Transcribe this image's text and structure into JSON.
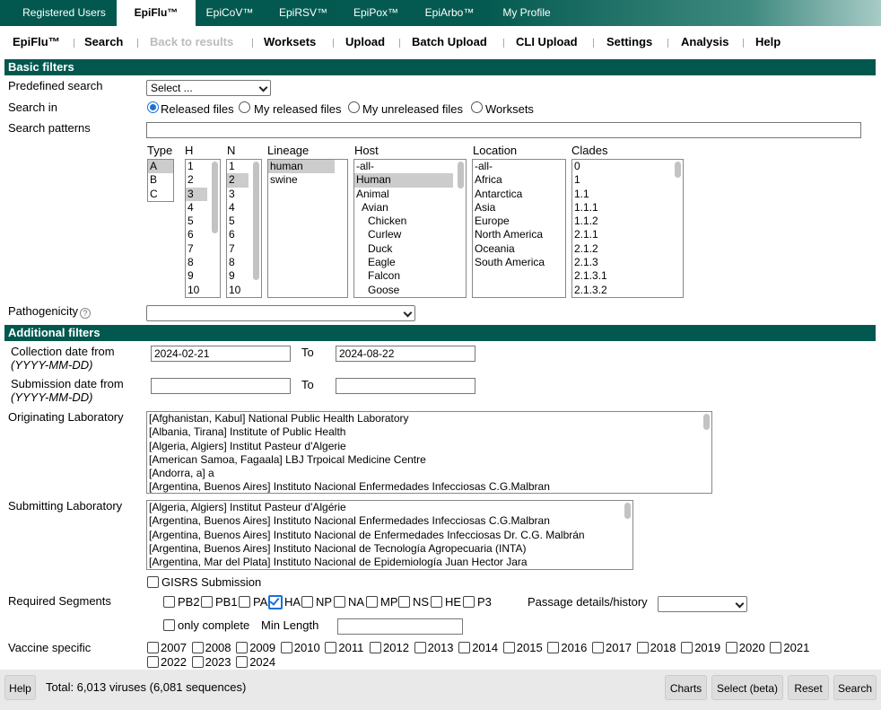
{
  "top_tabs": [
    "Registered Users",
    "EpiFlu™",
    "EpiCoV™",
    "EpiRSV™",
    "EpiPox™",
    "EpiArbo™",
    "My Profile"
  ],
  "sub_nav": [
    "EpiFlu™",
    "Search",
    "Back to results",
    "Worksets",
    "Upload",
    "Batch Upload",
    "CLI Upload",
    "Settings",
    "Analysis",
    "Help"
  ],
  "basic_filters": {
    "title": "Basic filters",
    "predefined_search_label": "Predefined search",
    "predefined_search_value": "Select ...",
    "search_in_label": "Search in",
    "search_in_options": [
      "Released files",
      "My released files",
      "My unreleased files",
      "Worksets"
    ],
    "search_patterns_label": "Search patterns",
    "search_patterns_value": "",
    "type": {
      "label": "Type",
      "items": [
        "A",
        "B",
        "C"
      ]
    },
    "h": {
      "label": "H",
      "items": [
        "1",
        "2",
        "3",
        "4",
        "5",
        "6",
        "7",
        "8",
        "9",
        "10"
      ]
    },
    "n": {
      "label": "N",
      "items": [
        "1",
        "2",
        "3",
        "4",
        "5",
        "6",
        "7",
        "8",
        "9",
        "10"
      ]
    },
    "lineage": {
      "label": "Lineage",
      "items": [
        "human",
        "swine"
      ]
    },
    "host": {
      "label": "Host",
      "items": [
        "-all-",
        "Human",
        "Animal",
        "Avian",
        "Chicken",
        "Curlew",
        "Duck",
        "Eagle",
        "Falcon",
        "Goose"
      ]
    },
    "location": {
      "label": "Location",
      "items": [
        "-all-",
        "Africa",
        "Antarctica",
        "Asia",
        "Europe",
        "North America",
        "Oceania",
        "South America"
      ]
    },
    "clades": {
      "label": "Clades",
      "items": [
        "0",
        "1",
        "1.1",
        "1.1.1",
        "1.1.2",
        "2.1.1",
        "2.1.2",
        "2.1.3",
        "2.1.3.1",
        "2.1.3.2"
      ]
    },
    "pathogenicity_label": "Pathogenicity",
    "pathogenicity_value": ""
  },
  "additional_filters": {
    "title": "Additional filters",
    "collection_date_label": "Collection date from",
    "date_format": "(YYYY-MM-DD)",
    "to_label": "To",
    "collection_from": "2024-02-21",
    "collection_to": "2024-08-22",
    "submission_date_label": "Submission date from",
    "submission_from": "",
    "submission_to": "",
    "originating_lab_label": "Originating Laboratory",
    "originating_labs": [
      "[Afghanistan, Kabul] National Public Health Laboratory",
      "[Albania, Tirana] Institute of Public Health",
      "[Algeria, Algiers] Institut Pasteur d'Algerie",
      "[American Samoa, Fagaala] LBJ Trpoical Medicine Centre",
      "[Andorra, a] a",
      "[Argentina, Buenos Aires] Instituto Nacional Enfermedades Infecciosas C.G.Malbran"
    ],
    "submitting_lab_label": "Submitting Laboratory",
    "submitting_labs": [
      "[Algeria, Algiers] Institut Pasteur d'Algérie",
      "[Argentina, Buenos Aires] Instituto Nacional Enfermedades Infecciosas C.G.Malbran",
      "[Argentina, Buenos Aires] Instituto Nacional de Enfermedades Infecciosas Dr. C.G. Malbrán",
      "[Argentina, Buenos Aires] Instituto Nacional de Tecnología Agropecuaria (INTA)",
      "[Argentina, Mar del Plata] Instituto Nacional de Epidemiología Juan Hector Jara"
    ],
    "gisrs_label": "GISRS Submission",
    "required_segments_label": "Required Segments",
    "segments": [
      "PB2",
      "PB1",
      "PA",
      "HA",
      "NP",
      "NA",
      "MP",
      "NS",
      "HE",
      "P3"
    ],
    "only_complete_label": "only complete",
    "min_length_label": "Min Length",
    "min_length_value": "",
    "passage_label": "Passage details/history",
    "passage_value": "",
    "vaccine_label": "Vaccine specific",
    "vaccine_years": [
      "2007",
      "2008",
      "2009",
      "2010",
      "2011",
      "2012",
      "2013",
      "2014",
      "2015",
      "2016",
      "2017",
      "2018",
      "2019",
      "2020",
      "2021",
      "2022",
      "2023",
      "2024"
    ]
  },
  "footer": {
    "help": "Help",
    "total": "Total: 6,013 viruses (6,081 sequences)",
    "buttons": [
      "Charts",
      "Select (beta)",
      "Reset",
      "Search"
    ]
  }
}
